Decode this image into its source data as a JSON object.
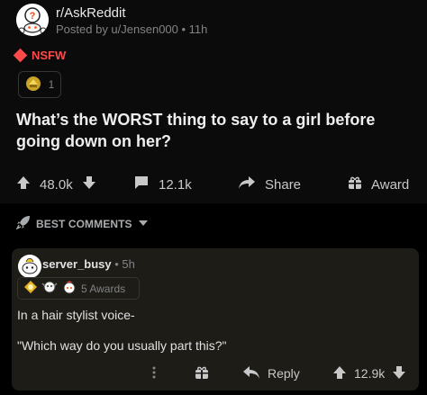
{
  "post": {
    "subreddit": "r/AskReddit",
    "meta": "Posted by u/Jensen000 • 11h",
    "nsfw_label": "NSFW",
    "award_count": "1",
    "title": "What’s the WORST thing to say to a girl before going down on her?",
    "actions": {
      "upvotes": "48.0k",
      "comments": "12.1k",
      "share": "Share",
      "award": "Award"
    }
  },
  "sort": {
    "label": "BEST COMMENTS"
  },
  "comment": {
    "username": "server_busy",
    "time": "• 5h",
    "awards_label": "5 Awards",
    "line1": "In a hair stylist voice-",
    "line2": "\"Which way do you usually part this?\"",
    "actions": {
      "reply": "Reply",
      "upvotes": "12.9k"
    }
  },
  "colors": {
    "background": "#000000",
    "post_bg": "#0b0b0b",
    "comment_bg": "#1d1c17",
    "nsfw": "#ff4a4a",
    "text": "#d7dadc"
  },
  "icons": [
    "snoo-avatar-icon",
    "nsfw-diamond-icon",
    "award-icon",
    "upvote-icon",
    "downvote-icon",
    "comment-icon",
    "share-icon",
    "gift-icon",
    "rocket-icon",
    "chevron-down-icon",
    "more-dots-icon",
    "reply-icon"
  ]
}
